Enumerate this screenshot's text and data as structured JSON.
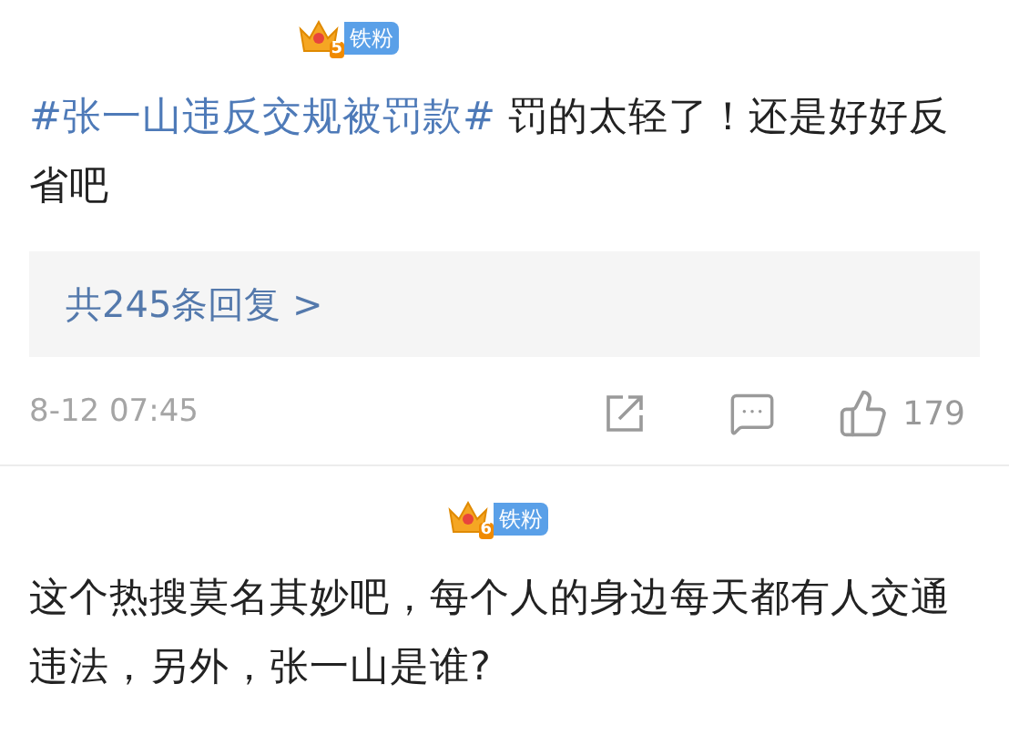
{
  "comments": [
    {
      "badge": {
        "level": "5",
        "label": "铁粉"
      },
      "topic": "#张一山违反交规被罚款#",
      "text": "罚的太轻了！还是好好反省吧",
      "replies": "共245条回复 >",
      "time": "8-12 07:45",
      "likes": "179"
    },
    {
      "badge": {
        "level": "6",
        "label": "铁粉"
      },
      "text": "这个热搜莫名其妙吧，每个人的身边每天都有人交通违法，另外，张一山是谁?"
    }
  ]
}
